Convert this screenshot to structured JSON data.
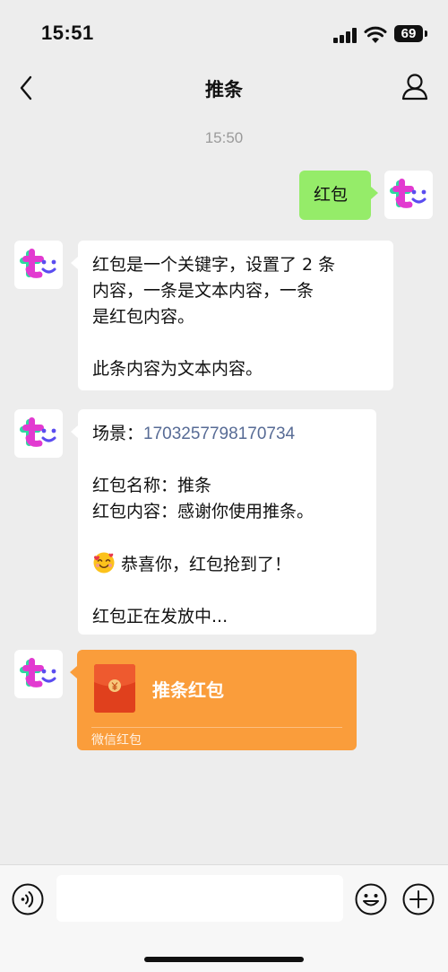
{
  "status_bar": {
    "time": "15:51",
    "battery": "69"
  },
  "header": {
    "title": "推条"
  },
  "chat": {
    "timestamp": "15:50",
    "msg_out": {
      "text": "红包"
    },
    "msg1": {
      "lines": [
        "红包是一个关键字，设置了 2 条",
        "内容，一条是文本内容，一条",
        "是红包内容。"
      ],
      "line2": "此条内容为文本内容。"
    },
    "msg2": {
      "scene_label": "场景：",
      "scene_id": "1703257798170734",
      "name_line": "红包名称：推条",
      "content_line": "红包内容：感谢你使用推条。",
      "congrats": "恭喜你，红包抢到了！",
      "distributing": "红包正在发放中..."
    },
    "packet": {
      "title": "推条红包",
      "footer": "微信红包",
      "colors": {
        "background": "#fa9d3b",
        "icon": "#e0401d"
      }
    }
  },
  "input_bar": {
    "placeholder": ""
  },
  "colors": {
    "outgoing_bubble": "#95ec69",
    "incoming_bubble": "#ffffff",
    "background": "#ededed",
    "link": "#576b95"
  },
  "icons": [
    "back-chevron-icon",
    "person-icon",
    "voice-icon",
    "emoji-icon",
    "plus-icon",
    "smiling-face-with-hearts-emoji",
    "yuan-coin-icon"
  ]
}
